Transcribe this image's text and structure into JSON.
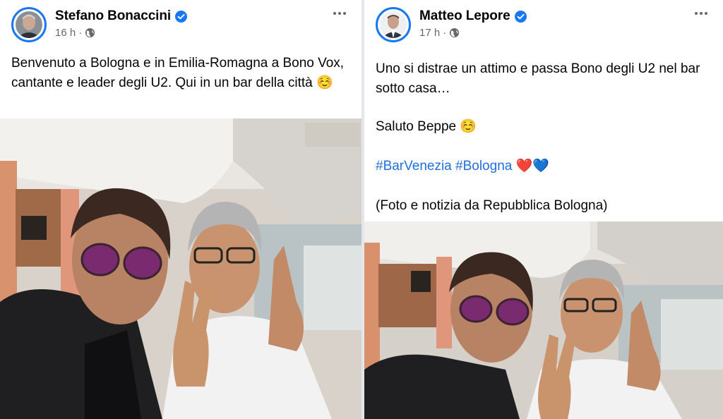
{
  "left_post": {
    "author": "Stefano Bonaccini",
    "time": "16 h",
    "separator": "·",
    "text": "Benvenuto a Bologna e in Emilia-Romagna a Bono Vox, cantante e leader degli U2. Qui in un bar della città ☺️"
  },
  "right_post": {
    "author": "Matteo Lepore",
    "time": "17 h",
    "separator": "·",
    "line1": "Uno si distrae un attimo e passa Bono degli U2 nel bar sotto casa…",
    "line2": "Saluto Beppe ☺️",
    "hashtag1": "#BarVenezia",
    "hashtag2": "#Bologna",
    "hearts": "❤️💙",
    "line4": "(Foto e notizia da Repubblica Bologna)"
  },
  "icons": {
    "verified": "verified-badge-icon",
    "globe": "globe-icon",
    "more": "more-options-icon"
  },
  "colors": {
    "verified": "#1877f2",
    "hashtag": "#216fdb",
    "meta": "#65676b"
  }
}
